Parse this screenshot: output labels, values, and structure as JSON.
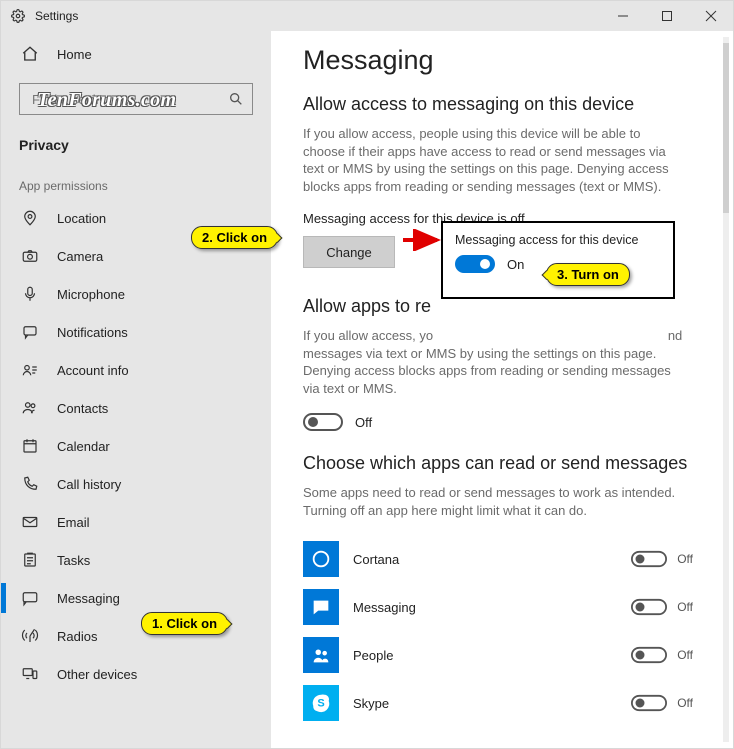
{
  "window": {
    "title": "Settings"
  },
  "watermark": "TenForums.com",
  "sidebar": {
    "home": "Home",
    "search_placeholder": "Find a setting",
    "section": "Privacy",
    "subhead": "App permissions",
    "items": [
      {
        "id": "location",
        "label": "Location"
      },
      {
        "id": "camera",
        "label": "Camera"
      },
      {
        "id": "microphone",
        "label": "Microphone"
      },
      {
        "id": "notifications",
        "label": "Notifications"
      },
      {
        "id": "account-info",
        "label": "Account info"
      },
      {
        "id": "contacts",
        "label": "Contacts"
      },
      {
        "id": "calendar",
        "label": "Calendar"
      },
      {
        "id": "call-history",
        "label": "Call history"
      },
      {
        "id": "email",
        "label": "Email"
      },
      {
        "id": "tasks",
        "label": "Tasks"
      },
      {
        "id": "messaging",
        "label": "Messaging",
        "selected": true
      },
      {
        "id": "radios",
        "label": "Radios"
      },
      {
        "id": "other-devices",
        "label": "Other devices"
      }
    ]
  },
  "main": {
    "page_title": "Messaging",
    "section1": {
      "heading": "Allow access to messaging on this device",
      "desc": "If you allow access, people using this device will be able to choose if their apps have access to read or send messages via text or MMS by using the settings on this page. Denying access blocks apps from reading or sending messages (text or MMS).",
      "status": "Messaging access for this device is off",
      "button": "Change"
    },
    "section2": {
      "heading_full": "Allow apps to read or send messages",
      "heading_visible": "Allow apps to re",
      "desc_visible_prefix": "If you allow access, yo",
      "desc_visible_suffix_line1": "nd",
      "desc_rest": "messages via text or MMS by using the settings on this page. Denying access blocks apps from reading or sending messages via text or MMS.",
      "toggle_state": "Off"
    },
    "section3": {
      "heading": "Choose which apps can read or send messages",
      "desc": "Some apps need to read or send messages to work as intended. Turning off an app here might limit what it can do.",
      "apps": [
        {
          "name": "Cortana",
          "color": "#0078d7",
          "state": "Off"
        },
        {
          "name": "Messaging",
          "color": "#0078d7",
          "state": "Off"
        },
        {
          "name": "People",
          "color": "#0078d7",
          "state": "Off"
        },
        {
          "name": "Skype",
          "color": "#00aff0",
          "state": "Off"
        }
      ]
    }
  },
  "popup": {
    "title": "Messaging access for this device",
    "toggle_state": "On"
  },
  "annotations": {
    "step1": "1. Click on",
    "step2": "2. Click on",
    "step3": "3. Turn on"
  }
}
